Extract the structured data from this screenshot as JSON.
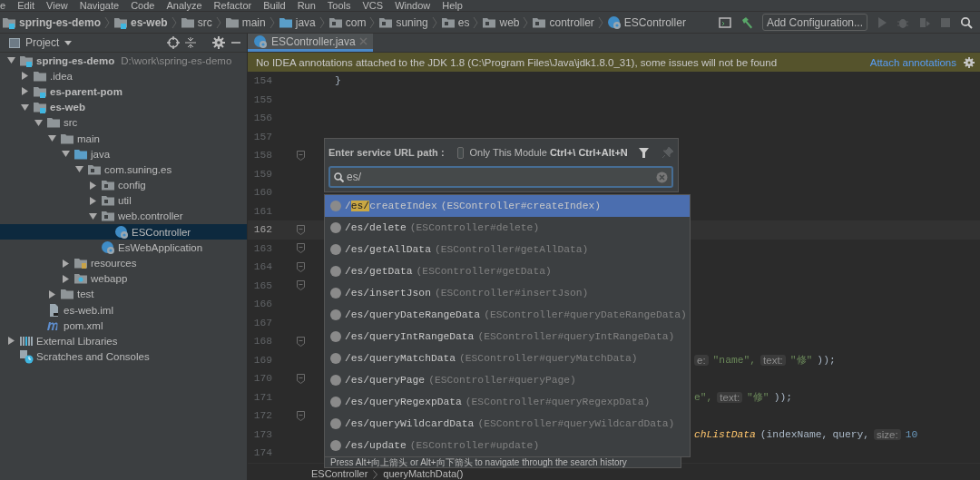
{
  "menu": [
    "e",
    "Edit",
    "View",
    "Navigate",
    "Code",
    "Analyze",
    "Refactor",
    "Build",
    "Run",
    "Tools",
    "VCS",
    "Window",
    "Help"
  ],
  "breadcrumbs": [
    {
      "label": "spring-es-demo",
      "kind": "module"
    },
    {
      "label": "es-web",
      "kind": "module"
    },
    {
      "label": "src",
      "kind": "folder"
    },
    {
      "label": "main",
      "kind": "folder"
    },
    {
      "label": "java",
      "kind": "source"
    },
    {
      "label": "com",
      "kind": "package"
    },
    {
      "label": "suning",
      "kind": "package"
    },
    {
      "label": "es",
      "kind": "package"
    },
    {
      "label": "web",
      "kind": "package"
    },
    {
      "label": "controller",
      "kind": "package"
    },
    {
      "label": "ESController",
      "kind": "class"
    }
  ],
  "toolbar": {
    "config_button": "Add Configuration..."
  },
  "project_panel": {
    "title": "Project",
    "tree": [
      {
        "label": "spring-es-demo",
        "path": "D:\\work\\spring-es-demo",
        "kind": "module",
        "expanded": true,
        "selected": false,
        "children": [
          {
            "label": ".idea",
            "kind": "folder",
            "expanded": false,
            "selected": false
          },
          {
            "label": "es-parent-pom",
            "kind": "module",
            "expanded": false,
            "selected": false
          },
          {
            "label": "es-web",
            "kind": "module",
            "expanded": true,
            "selected": false,
            "children": [
              {
                "label": "src",
                "kind": "folder",
                "expanded": true,
                "selected": false,
                "children": [
                  {
                    "label": "main",
                    "kind": "folder",
                    "expanded": true,
                    "selected": false,
                    "children": [
                      {
                        "label": "java",
                        "kind": "source",
                        "expanded": true,
                        "selected": false,
                        "children": [
                          {
                            "label": "com.suning.es",
                            "kind": "package",
                            "expanded": true,
                            "selected": false,
                            "children": [
                              {
                                "label": "config",
                                "kind": "package",
                                "expanded": false,
                                "selected": false
                              },
                              {
                                "label": "util",
                                "kind": "package",
                                "expanded": false,
                                "selected": false
                              },
                              {
                                "label": "web.controller",
                                "kind": "package",
                                "expanded": true,
                                "selected": false,
                                "children": [
                                  {
                                    "label": "ESController",
                                    "kind": "class",
                                    "selected": true
                                  }
                                ]
                              },
                              {
                                "label": "EsWebApplication",
                                "kind": "class",
                                "selected": false
                              }
                            ]
                          }
                        ]
                      },
                      {
                        "label": "resources",
                        "kind": "resources",
                        "expanded": false,
                        "selected": false
                      },
                      {
                        "label": "webapp",
                        "kind": "webapp",
                        "expanded": false,
                        "selected": false
                      }
                    ]
                  },
                  {
                    "label": "test",
                    "kind": "folder",
                    "expanded": false,
                    "selected": false
                  }
                ]
              },
              {
                "label": "es-web.iml",
                "kind": "iml",
                "selected": false
              },
              {
                "label": "pom.xml",
                "kind": "maven",
                "selected": false
              }
            ]
          }
        ]
      },
      {
        "label": "External Libraries",
        "kind": "libraries",
        "expanded": false,
        "selected": false
      },
      {
        "label": "Scratches and Consoles",
        "kind": "scratches",
        "selected": false
      }
    ]
  },
  "editor": {
    "tab": {
      "label": "ESController.java",
      "selected": true
    },
    "banner": {
      "message": "No IDEA annotations attached to the JDK 1.8 (C:\\Program Files\\Java\\jdk1.8.0_31), some issues will not be found",
      "link": "Attach annotations"
    },
    "lines": [
      {
        "number": "154",
        "current": false,
        "fold": false,
        "kind": "block",
        "code": [
          {
            "kind": "code",
            "text": "}"
          }
        ]
      },
      {
        "number": "155",
        "current": false,
        "fold": false
      },
      {
        "number": "156",
        "current": false,
        "fold": false
      },
      {
        "number": "157",
        "current": false,
        "fold": false
      },
      {
        "number": "158",
        "current": false,
        "fold": true
      },
      {
        "number": "159",
        "current": false,
        "fold": false
      },
      {
        "number": "160",
        "current": false,
        "fold": false
      },
      {
        "number": "161",
        "current": false,
        "fold": false
      },
      {
        "number": "162",
        "current": true,
        "fold": true
      },
      {
        "number": "163",
        "current": false,
        "fold": true
      },
      {
        "number": "164",
        "current": false,
        "fold": true
      },
      {
        "number": "165",
        "current": false,
        "fold": true
      },
      {
        "number": "166",
        "current": false,
        "fold": false
      },
      {
        "number": "167",
        "current": false,
        "fold": false
      },
      {
        "number": "168",
        "current": false,
        "fold": true
      },
      {
        "number": "169",
        "current": false,
        "fold": false,
        "kind": "fragment",
        "code": [
          {
            "kind": "hint",
            "text": "e:"
          },
          {
            "kind": "string",
            "text": "\"name\","
          },
          {
            "kind": "hint",
            "text": "text:"
          },
          {
            "kind": "string",
            "text": "\"修\""
          },
          {
            "kind": "code",
            "text": "));"
          }
        ]
      },
      {
        "number": "170",
        "current": false,
        "fold": true
      },
      {
        "number": "171",
        "current": false,
        "fold": false,
        "kind": "fragment",
        "code": [
          {
            "kind": "string",
            "text": "e\","
          },
          {
            "kind": "hint",
            "text": "text:"
          },
          {
            "kind": "string",
            "text": "\"修\""
          },
          {
            "kind": "code",
            "text": "));"
          }
        ]
      },
      {
        "number": "172",
        "current": false,
        "fold": true
      },
      {
        "number": "173",
        "current": false,
        "fold": false,
        "kind": "fragment",
        "code": [
          {
            "kind": "method",
            "text": "chListData"
          },
          {
            "kind": "code",
            "text": "(indexName,"
          },
          {
            "kind": "code",
            "text": "query,"
          },
          {
            "kind": "hint",
            "text": "size:"
          },
          {
            "kind": "number",
            "text": "10"
          }
        ]
      },
      {
        "number": "174",
        "current": false,
        "fold": false
      }
    ],
    "status_path": [
      "ESController",
      "queryMatchData()"
    ]
  },
  "popup": {
    "title": "Enter service URL path :",
    "only_module": {
      "checked": false,
      "label": "Only This Module **Ctrl+\\ Ctrl+Alt+N**"
    },
    "search": {
      "value": "es/"
    },
    "results": [
      {
        "path": [
          {
            "text": "/",
            "match": false
          },
          {
            "text": "es/",
            "match": true
          },
          {
            "text": "createIndex",
            "match": false
          }
        ],
        "method": "(ESController#createIndex)",
        "selected": true
      },
      {
        "path": [
          {
            "text": "/es/delete",
            "match": false
          }
        ],
        "method": "(ESController#delete)",
        "selected": false
      },
      {
        "path": [
          {
            "text": "/es/getAllData",
            "match": false
          }
        ],
        "method": "(ESController#getAllData)",
        "selected": false
      },
      {
        "path": [
          {
            "text": "/es/getData",
            "match": false
          }
        ],
        "method": "(ESController#getData)",
        "selected": false
      },
      {
        "path": [
          {
            "text": "/es/insertJson",
            "match": false
          }
        ],
        "method": "(ESController#insertJson)",
        "selected": false
      },
      {
        "path": [
          {
            "text": "/es/queryDateRangeData",
            "match": false
          }
        ],
        "method": "(ESController#queryDateRangeData)",
        "selected": false
      },
      {
        "path": [
          {
            "text": "/es/queryIntRangeData",
            "match": false
          }
        ],
        "method": "(ESController#queryIntRangeData)",
        "selected": false
      },
      {
        "path": [
          {
            "text": "/es/queryMatchData",
            "match": false
          }
        ],
        "method": "(ESController#queryMatchData)",
        "selected": false
      },
      {
        "path": [
          {
            "text": "/es/queryPage",
            "match": false
          }
        ],
        "method": "(ESController#queryPage)",
        "selected": false
      },
      {
        "path": [
          {
            "text": "/es/queryRegexpData",
            "match": false
          }
        ],
        "method": "(ESController#queryRegexpData)",
        "selected": false
      },
      {
        "path": [
          {
            "text": "/es/queryWildcardData",
            "match": false
          }
        ],
        "method": "(ESController#queryWildcardData)",
        "selected": false
      },
      {
        "path": [
          {
            "text": "/es/update",
            "match": false
          }
        ],
        "method": "(ESController#update)",
        "selected": false
      }
    ],
    "footer": "Press Alt+向上箭头 or Alt+向下箭头 to navigate through the search history"
  }
}
